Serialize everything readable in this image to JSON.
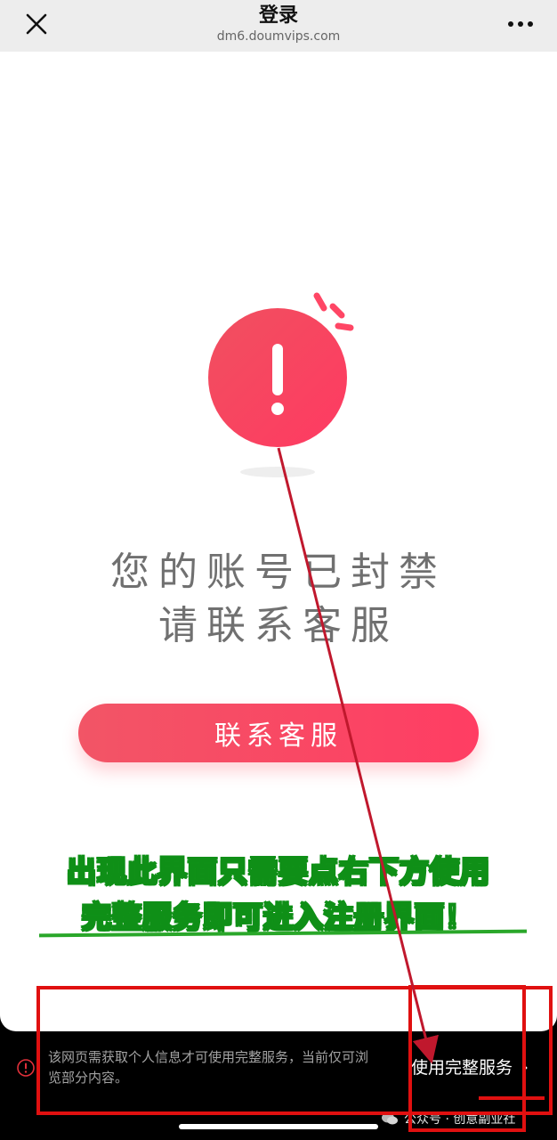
{
  "header": {
    "title": "登录",
    "url": "dm6.doumvips.com",
    "close_icon": "close-icon",
    "more_icon": "more-dots-icon"
  },
  "main": {
    "alert_icon": "exclamation-alert-icon",
    "message_line1": "您的账号已封禁",
    "message_line2": "请联系客服",
    "contact_button": "联系客服"
  },
  "annotation": {
    "line1": "出现此界面只需要点右下方使用",
    "line2": "完整服务即可进入注册界面！"
  },
  "bottom": {
    "notice": "该网页需获取个人信息才可使用完整服务，当前仅可浏览部分内容。",
    "full_service": "使用完整服务",
    "chevron": "›",
    "watermark": "公众号 · 创意副业社"
  },
  "colors": {
    "accent": "#ff3d63",
    "annotation_red": "#e01010",
    "arrow": "#c0182d",
    "annotation_green": "#0f8f17"
  }
}
